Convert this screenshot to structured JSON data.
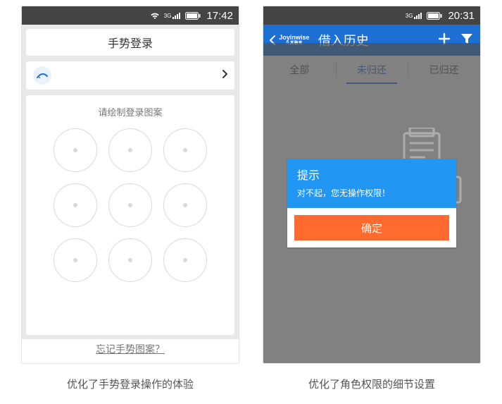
{
  "phone1": {
    "status_time": "17:42",
    "sig_label": "3G",
    "title": "手势登录",
    "hint": "请绘制登录图案",
    "forgot": "忘记手势图案？"
  },
  "phone2": {
    "status_time": "20:31",
    "sig_label": "3G",
    "logo_main": "Joyinwise",
    "logo_sub": "久其融资",
    "header_title": "借入历史",
    "tabs": {
      "all": "全部",
      "unreturned": "未归还",
      "returned": "已归还"
    },
    "dialog": {
      "title": "提示",
      "message": "对不起，您无操作权限！",
      "ok": "确定"
    }
  },
  "captions": {
    "left": "优化了手势登录操作的体验",
    "right": "优化了角色权限的细节设置"
  }
}
